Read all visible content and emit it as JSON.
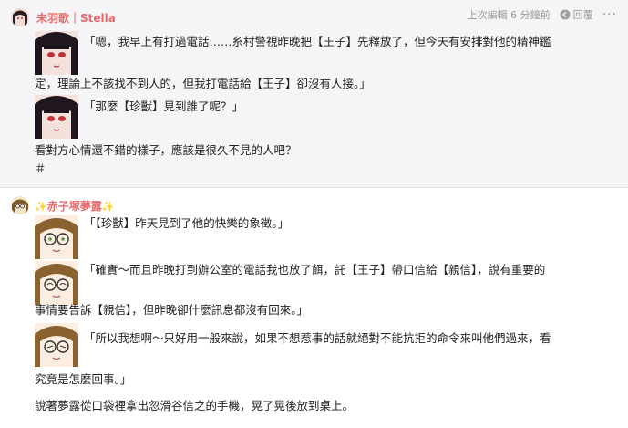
{
  "post1": {
    "author": "未羽歌｜Stella",
    "timestamp": "上次編輯 6 分鐘前",
    "reply_label": "回覆",
    "more_label": "···",
    "lines": [
      "「嗯，我早上有打過電話……糸村警視昨晚把【王子】先釋放了，但今天有安排對他的精神鑑",
      "定，理論上不該找不到人的，但我打電話給【王子】卻沒有人接。」",
      "「那麼【珍獸】見到誰了呢？」",
      "看對方心情還不錯的樣子，應該是很久不見的人吧？",
      "＃"
    ]
  },
  "post2": {
    "author": "赤子塚夢露",
    "sparkle_left": "✨",
    "sparkle_right": "✨",
    "lines": [
      "「【珍獸】昨天見到了他的快樂的象徵。」",
      "「確實～而且昨晚打到辦公室的電話我也放了餌，託【王子】帶口信給【親信】，說有重要的",
      "事情要告訴【親信】，但昨晚卻什麼訊息都沒有回來。」",
      "「所以我想啊～只好用一般來說，如果不想惹事的話就絕對不能抗拒的命令來叫他們過來，看",
      "究竟是怎麼回事。」",
      "說著夢露從口袋裡拿出忽滑谷信之的手機，晃了晃後放到桌上。"
    ]
  }
}
